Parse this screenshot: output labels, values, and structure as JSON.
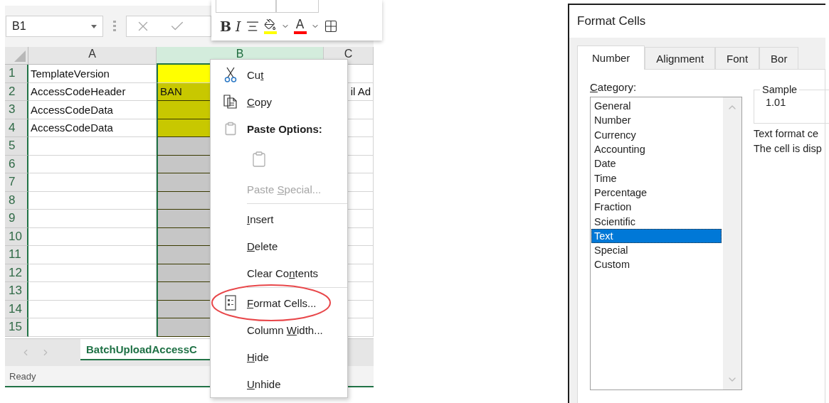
{
  "workbook": {
    "name_box": "B1",
    "mini_toolbar": [
      {
        "kind": "bold",
        "label": "B"
      },
      {
        "kind": "italic",
        "label": "I"
      },
      {
        "kind": "align"
      },
      {
        "kind": "fill",
        "color": "#ffff00"
      },
      {
        "kind": "caret"
      },
      {
        "kind": "font-color",
        "label": "A",
        "color": "#ff0000"
      },
      {
        "kind": "caret"
      },
      {
        "kind": "borders"
      }
    ],
    "columns": [
      {
        "label": "A",
        "selected": false
      },
      {
        "label": "B",
        "selected": true
      },
      {
        "label": "C",
        "selected": false
      }
    ],
    "rows": [
      {
        "number": "1",
        "a": "TemplateVersion",
        "b": {
          "color": "#ffff00"
        }
      },
      {
        "number": "2",
        "a": "AccessCodeHeader",
        "b": {
          "text": "BAN",
          "color": "#c8c800"
        },
        "c": "il Ad"
      },
      {
        "number": "3",
        "a": "AccessCodeData",
        "b": {
          "color": "#c8c800"
        }
      },
      {
        "number": "4",
        "a": "AccessCodeData",
        "b": {
          "color": "#c8c800"
        }
      },
      {
        "number": "5",
        "b": {
          "color": "#c6c6c6"
        }
      },
      {
        "number": "6",
        "b": {
          "color": "#c6c6c6"
        }
      },
      {
        "number": "7",
        "b": {
          "color": "#c6c6c6"
        }
      },
      {
        "number": "8",
        "b": {
          "color": "#c6c6c6"
        }
      },
      {
        "number": "9",
        "b": {
          "color": "#c6c6c6"
        }
      },
      {
        "number": "10",
        "b": {
          "color": "#c6c6c6"
        }
      },
      {
        "number": "11",
        "b": {
          "color": "#c6c6c6"
        }
      },
      {
        "number": "12",
        "b": {
          "color": "#c6c6c6"
        }
      },
      {
        "number": "13",
        "b": {
          "color": "#c6c6c6"
        }
      },
      {
        "number": "14",
        "b": {
          "color": "#c6c6c6"
        }
      },
      {
        "number": "15",
        "b": {
          "color": "#c6c6c6"
        }
      }
    ],
    "sheet_tab": {
      "label": "BatchUploadAccessC",
      "selected": true
    },
    "status": "Ready"
  },
  "context_menu": [
    {
      "kind": "cut",
      "pre": "Cu",
      "key": "t",
      "disabled": false
    },
    {
      "kind": "copy",
      "key": "C",
      "post": "opy",
      "disabled": false
    },
    {
      "kind": "paste-header",
      "post": "Paste Options:",
      "disabled": false
    },
    {
      "kind": "paste-button",
      "disabled": false
    },
    {
      "kind": "command",
      "pre": "Paste ",
      "key": "S",
      "post": "pecial...",
      "disabled": true
    },
    {
      "kind": "separator"
    },
    {
      "kind": "command",
      "key": "I",
      "post": "nsert",
      "disabled": false
    },
    {
      "kind": "command",
      "key": "D",
      "post": "elete",
      "disabled": false
    },
    {
      "kind": "command",
      "pre": "Clear Co",
      "key": "n",
      "post": "tents",
      "disabled": false
    },
    {
      "kind": "separator"
    },
    {
      "kind": "format",
      "key": "F",
      "post": "ormat Cells...",
      "disabled": false,
      "highlighted": true
    },
    {
      "kind": "command",
      "pre": "Column ",
      "key": "W",
      "post": "idth...",
      "disabled": false
    },
    {
      "kind": "command",
      "key": "H",
      "post": "ide",
      "disabled": false
    },
    {
      "kind": "command",
      "key": "U",
      "post": "nhide",
      "disabled": false
    }
  ],
  "dialog": {
    "title": "Format Cells",
    "tabs": [
      {
        "label": "Number",
        "selected": true
      },
      {
        "label": "Alignment",
        "selected": false
      },
      {
        "label": "Font",
        "selected": false
      },
      {
        "label": "Bor",
        "selected": false
      }
    ],
    "category_label": {
      "key": "C",
      "post": "ategory:"
    },
    "categories": [
      {
        "label": "General",
        "selected": false
      },
      {
        "label": "Number",
        "selected": false
      },
      {
        "label": "Currency",
        "selected": false
      },
      {
        "label": "Accounting",
        "selected": false
      },
      {
        "label": "Date",
        "selected": false
      },
      {
        "label": "Time",
        "selected": false
      },
      {
        "label": "Percentage",
        "selected": false
      },
      {
        "label": "Fraction",
        "selected": false
      },
      {
        "label": "Scientific",
        "selected": false
      },
      {
        "label": "Text",
        "selected": true
      },
      {
        "label": "Special",
        "selected": false
      },
      {
        "label": "Custom",
        "selected": false
      }
    ],
    "sample": {
      "legend": "Sample",
      "value": "1.01"
    },
    "description_lines": [
      "Text format ce",
      "The cell is disp"
    ]
  }
}
